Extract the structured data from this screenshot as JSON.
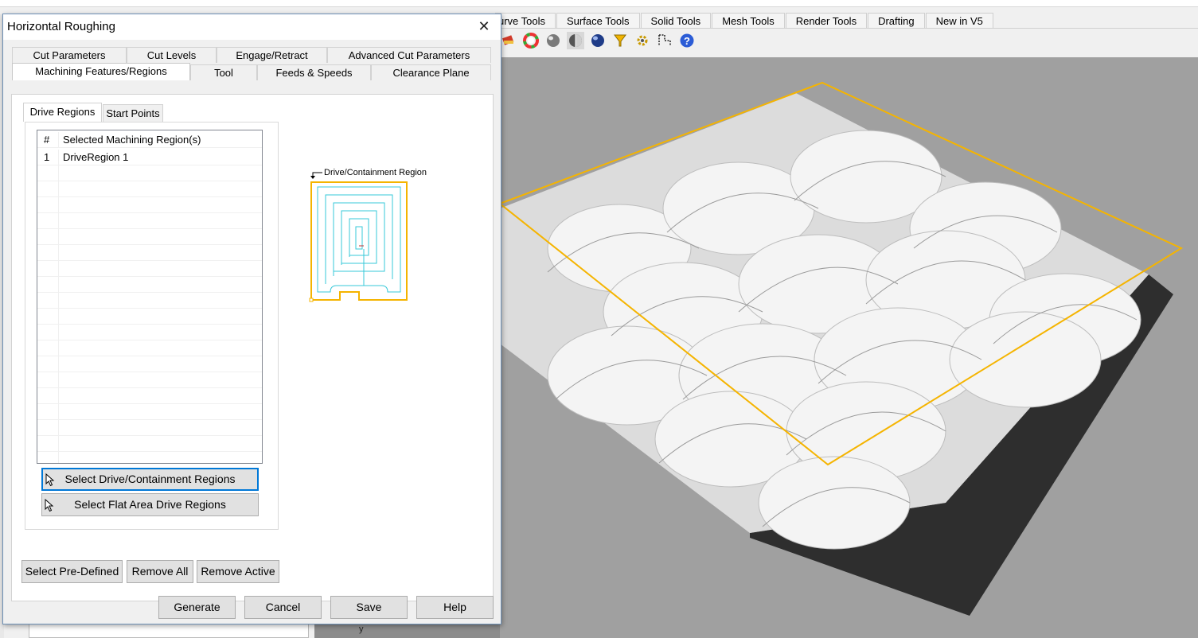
{
  "app": {
    "toolbar_tabs": [
      "urve Tools",
      "Surface Tools",
      "Solid Tools",
      "Mesh Tools",
      "Render Tools",
      "Drafting",
      "New in V5"
    ],
    "toolbar_icons": [
      "render-icon",
      "color-wheel-icon",
      "sphere-gray-icon",
      "sphere-split-icon",
      "sphere-blue-icon",
      "filter-icon",
      "gear-icon",
      "dimension-icon",
      "help-icon"
    ],
    "viewport_axis_label": "y"
  },
  "dialog": {
    "title": "Horizontal Roughing",
    "close_glyph": "✕",
    "tabs_row1": [
      "Cut Parameters",
      "Cut Levels",
      "Engage/Retract",
      "Advanced Cut Parameters"
    ],
    "tabs_row2": [
      "Machining Features/Regions",
      "Tool",
      "Feeds & Speeds",
      "Clearance Plane"
    ],
    "active_tab": "Machining Features/Regions",
    "subtabs": [
      "Drive Regions",
      "Start Points"
    ],
    "active_subtab": "Drive Regions",
    "table": {
      "headers": [
        "#",
        "Selected Machining Region(s)"
      ],
      "rows": [
        {
          "index": "1",
          "name": "DriveRegion 1"
        }
      ]
    },
    "diagram_label": "Drive/Containment Region",
    "buttons": {
      "select_drive": "Select Drive/Containment Regions",
      "select_flat": "Select Flat Area Drive Regions",
      "select_predefined": "Select Pre-Defined",
      "remove_all": "Remove All",
      "remove_active": "Remove Active"
    },
    "footer": {
      "generate": "Generate",
      "cancel": "Cancel",
      "save": "Save",
      "help": "Help"
    }
  },
  "colors": {
    "region_outline": "#f5b400",
    "toolpath": "#37c8d8",
    "viewport_bg": "#a0a0a0",
    "focus": "#0078d7"
  }
}
